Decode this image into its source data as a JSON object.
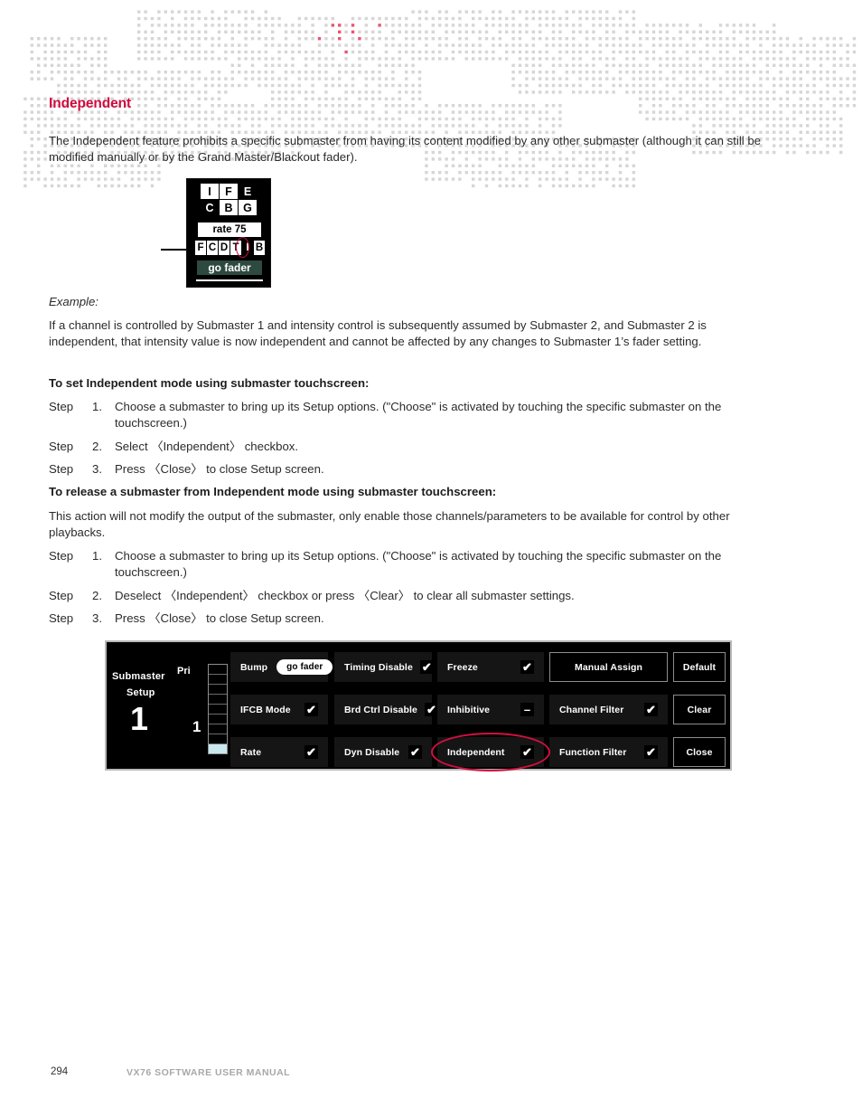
{
  "heading": "Independent",
  "intro_paragraph": "The Independent feature prohibits a specific submaster from having its content modified by any other submaster (although it can still be modified manually or by the Grand Master/Blackout fader).",
  "example_label": "Example:",
  "example_paragraph": "If a channel is controlled by Submaster 1 and intensity control is subsequently assumed by Submaster 2, and Submaster 2 is independent, that intensity value is now independent and cannot be affected by any changes to Submaster 1’s fader setting.",
  "section_set": {
    "heading": "To set Independent mode using submaster touchscreen:",
    "steps": [
      {
        "label": "Step",
        "num": "1.",
        "text": "Choose a submaster to bring up its Setup options. (\"Choose\" is activated by touching the specific submaster on the touchscreen.)"
      },
      {
        "label": "Step",
        "num": "2.",
        "text": "Select 〈Independent〉 checkbox."
      },
      {
        "label": "Step",
        "num": "3.",
        "text": "Press 〈Close〉 to close Setup screen."
      }
    ]
  },
  "section_release": {
    "heading": "To release a submaster from Independent mode using submaster touchscreen:",
    "note": "This action will not modify the output of the submaster, only enable those channels/parameters to be available for control by other playbacks.",
    "steps": [
      {
        "label": "Step",
        "num": "1.",
        "text": "Choose a submaster to bring up its Setup options. (\"Choose\" is activated by touching the specific submaster on the touchscreen.)"
      },
      {
        "label": "Step",
        "num": "2.",
        "text": "Deselect 〈Independent〉 checkbox or press 〈Clear〉 to clear all submaster settings."
      },
      {
        "label": "Step",
        "num": "3.",
        "text": "Press 〈Close〉 to close Setup screen."
      }
    ]
  },
  "submaster_widget": {
    "ifcb_grid": [
      [
        {
          "text": "I",
          "inverted": false
        },
        {
          "text": "F",
          "inverted": false
        },
        {
          "text": "E",
          "inverted": true
        }
      ],
      [
        {
          "text": "C",
          "inverted": true
        },
        {
          "text": "B",
          "inverted": false
        },
        {
          "text": "G",
          "inverted": false
        }
      ]
    ],
    "rate_label": "rate 75",
    "fcd_row": [
      {
        "text": "F",
        "inverted": false
      },
      {
        "text": "C",
        "inverted": false
      },
      {
        "text": "D",
        "inverted": false
      },
      {
        "text": "T",
        "inverted": false
      },
      {
        "text": "I",
        "inverted": true
      },
      {
        "text": "B",
        "inverted": false
      }
    ],
    "go_fader_label": "go fader",
    "highlight_letter": "I",
    "highlight_color": "#cf0a3e"
  },
  "touch_panel": {
    "submaster_word": "Submaster",
    "setup_word": "Setup",
    "submaster_number": "1",
    "pri_label": "Pri",
    "fader_value": "1",
    "fader_segments": 9,
    "fader_active_index": 8,
    "fader_active_color": "#c9e7ee",
    "buttons": [
      {
        "label": "Bump",
        "indicator": "pill",
        "pill_text": "go fader",
        "style": "filled"
      },
      {
        "label": "Timing Disable",
        "indicator": "check",
        "style": "filled"
      },
      {
        "label": "Freeze",
        "indicator": "check",
        "style": "filled"
      },
      {
        "label": "Manual Assign",
        "indicator": "none",
        "style": "outlined"
      },
      {
        "label": "Default",
        "indicator": "none",
        "style": "outlined"
      },
      {
        "label": "IFCB Mode",
        "indicator": "check",
        "style": "filled"
      },
      {
        "label": "Brd Ctrl Disable",
        "indicator": "check",
        "style": "filled"
      },
      {
        "label": "Inhibitive",
        "indicator": "dash",
        "style": "filled"
      },
      {
        "label": "Channel Filter",
        "indicator": "check",
        "style": "filled"
      },
      {
        "label": "Clear",
        "indicator": "none",
        "style": "outlined"
      },
      {
        "label": "Rate",
        "indicator": "check",
        "style": "filled"
      },
      {
        "label": "Dyn Disable",
        "indicator": "check",
        "style": "filled"
      },
      {
        "label": "Independent",
        "indicator": "check",
        "style": "filled",
        "highlighted": true
      },
      {
        "label": "Function Filter",
        "indicator": "check",
        "style": "filled"
      },
      {
        "label": "Close",
        "indicator": "none",
        "style": "outlined"
      }
    ],
    "check_glyph": "✔",
    "dash_glyph": "–",
    "highlight_color": "#d2103f"
  },
  "footer": {
    "page_number": "294",
    "manual_title": "VX76 SOFTWARE USER MANUAL"
  },
  "theme": {
    "heading_red": "#cf0a3e",
    "panel_bg": "#000000",
    "panel_border": "#b9b9b9",
    "button_bg": "#151515",
    "go_fader_bg": "#2e4a40",
    "watermark_gray": "#d6d6d6",
    "watermark_red": "#e8566f"
  }
}
